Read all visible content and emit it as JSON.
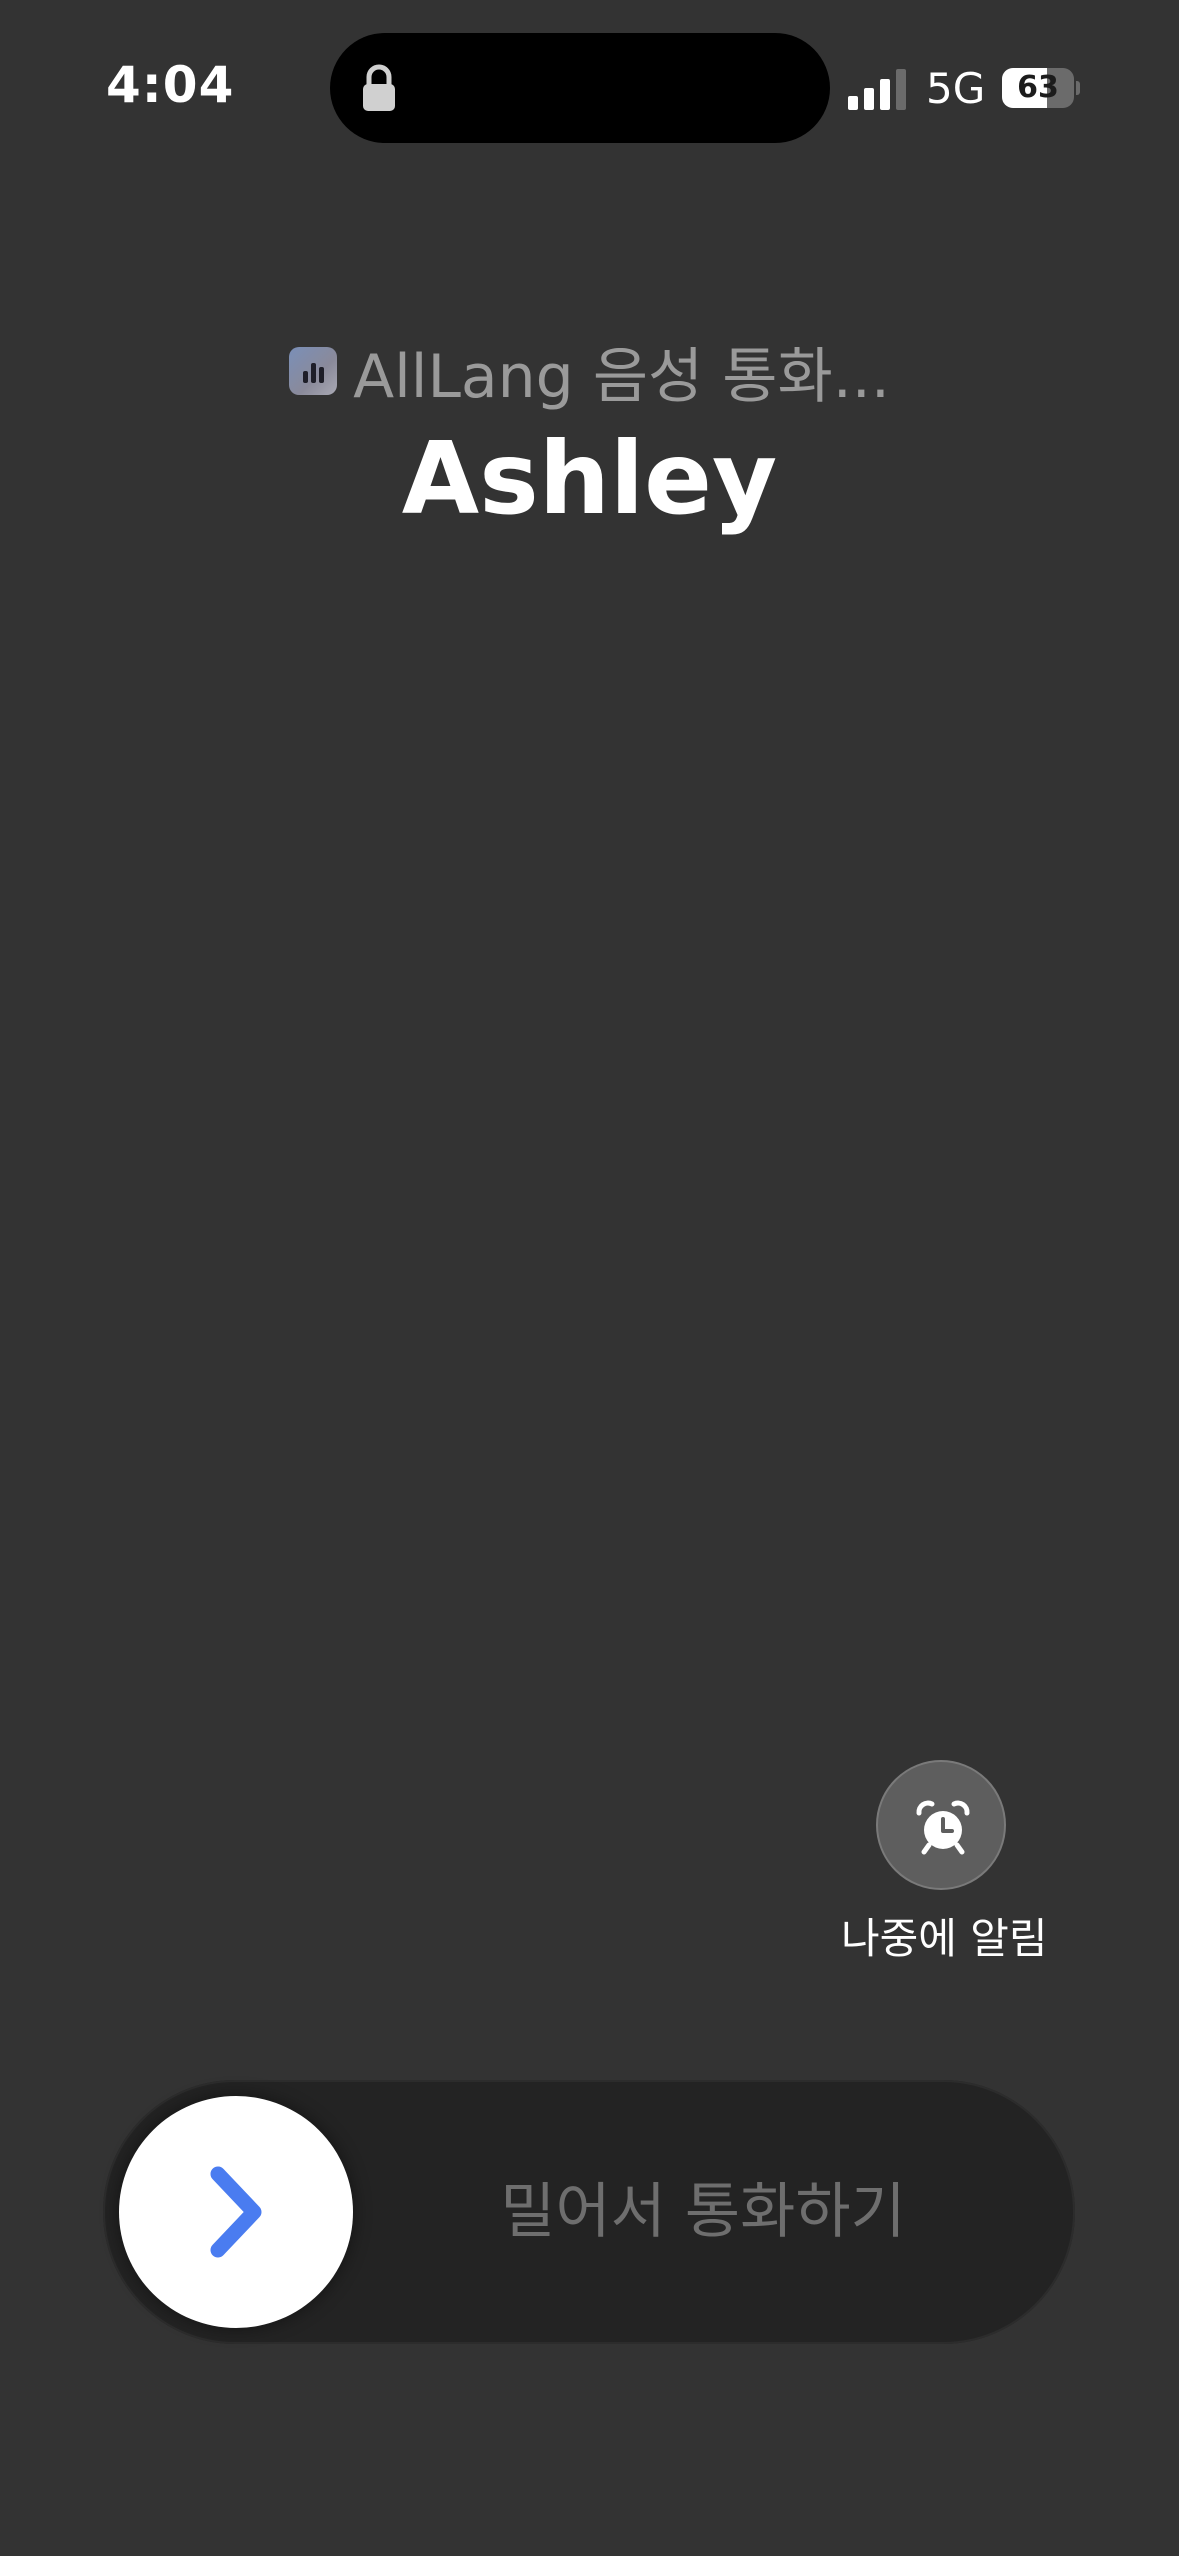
{
  "status_bar": {
    "time": "4:04",
    "network": "5G",
    "battery_level": "63",
    "battery_fraction": 0.63,
    "signal_bars_active": 3,
    "icons": [
      "lock-icon",
      "signal-icon",
      "battery-icon"
    ]
  },
  "call": {
    "app_label": "AllLang 음성 통화...",
    "app_icon": "alllang-app-icon",
    "caller_name": "Ashley"
  },
  "actions": {
    "remind_label": "나중에 알림",
    "remind_icon": "alarm-clock-icon"
  },
  "slider": {
    "label": "밀어서 통화하기",
    "knob_icon": "chevron-right-icon",
    "accent_color": "#4a7cf0"
  },
  "colors": {
    "background": "#333333",
    "slider_track": "#232323",
    "secondary_text": "#9a9a9a"
  }
}
